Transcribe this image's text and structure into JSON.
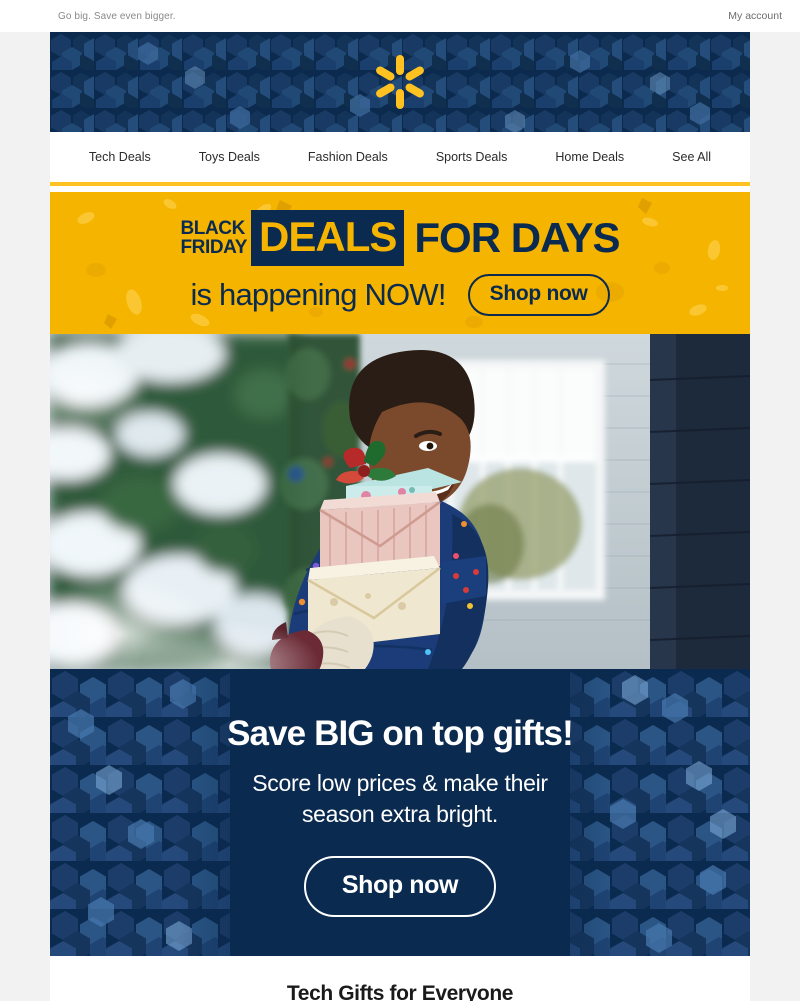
{
  "colors": {
    "navy": "#0b2a4f",
    "yellow": "#ffc220",
    "promo_yellow": "#f5b400",
    "page_bg": "#f2f2f2",
    "white": "#ffffff"
  },
  "preheader": {
    "tagline": "Go big. Save even bigger.",
    "account_label": "My account"
  },
  "masthead": {
    "logo_name": "walmart-spark-logo",
    "background": "navy-hexagon-confetti"
  },
  "nav": {
    "items": [
      {
        "label": "Tech Deals"
      },
      {
        "label": "Toys Deals"
      },
      {
        "label": "Fashion Deals"
      },
      {
        "label": "Sports Deals"
      },
      {
        "label": "Home Deals"
      },
      {
        "label": "See All"
      }
    ]
  },
  "promo_banner": {
    "eyebrow_line1": "BLACK",
    "eyebrow_line2": "FRIDAY",
    "boxed_word": "DEALS",
    "headline_rest": "FOR DAYS",
    "subline": "is happening NOW!",
    "cta_label": "Shop now"
  },
  "hero": {
    "alt": "Smiling boy in a navy polka-dot puffer coat carrying a stack of wrapped gifts on a snowy front porch"
  },
  "gift_panel": {
    "headline": "Save BIG on top gifts!",
    "subhead_line1": "Score low prices & make their",
    "subhead_line2": "season extra bright.",
    "cta_label": "Shop now"
  },
  "teaser": {
    "title": "Tech Gifts for Everyone"
  }
}
